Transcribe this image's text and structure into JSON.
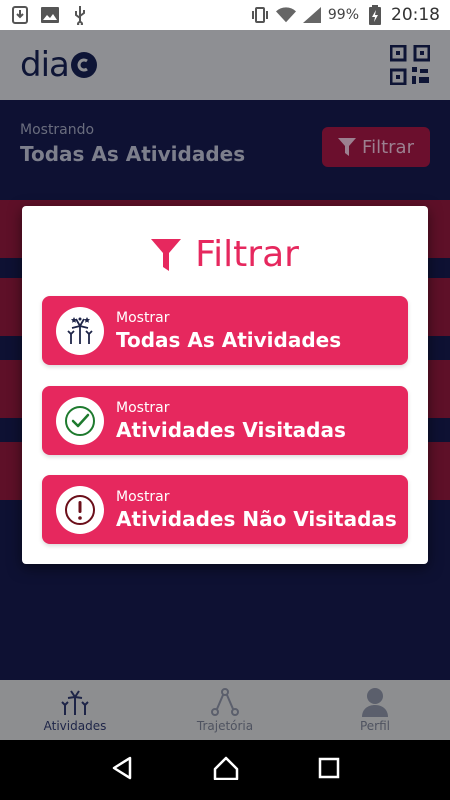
{
  "status_bar": {
    "battery": "99%",
    "time": "20:18"
  },
  "header": {
    "logo_text": "dia"
  },
  "filter_bar": {
    "showing_label": "Mostrando",
    "showing_value": "Todas As Atividades",
    "filter_button": "Filtrar"
  },
  "modal": {
    "title": "Filtrar",
    "options": [
      {
        "small": "Mostrar",
        "big": "Todas As Atividades",
        "icon": "fireworks-icon"
      },
      {
        "small": "Mostrar",
        "big": "Atividades Visitadas",
        "icon": "check-circle-icon"
      },
      {
        "small": "Mostrar",
        "big": "Atividades Não Visitadas",
        "icon": "alert-circle-icon"
      }
    ]
  },
  "bottom_nav": {
    "items": [
      {
        "label": "Atividades",
        "active": true
      },
      {
        "label": "Trajetória",
        "active": false
      },
      {
        "label": "Perfil",
        "active": false
      }
    ]
  },
  "colors": {
    "accent": "#e6285e",
    "navy": "#0e1536"
  }
}
